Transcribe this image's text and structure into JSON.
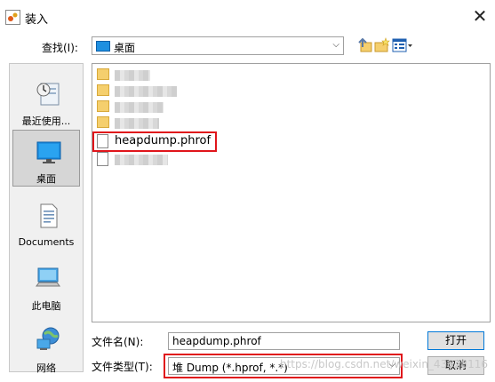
{
  "window": {
    "title": "装入",
    "close": "✕"
  },
  "lookin": {
    "label": "查找(I):",
    "value": "桌面",
    "arrow": "⌵"
  },
  "toolbar": {
    "icons": [
      "up-one-level-icon",
      "new-folder-icon",
      "view-menu-icon"
    ]
  },
  "places": [
    {
      "label": "最近使用...",
      "icon": "recent-items-icon"
    },
    {
      "label": "桌面",
      "icon": "desktop-icon",
      "selected": true
    },
    {
      "label": "Documents",
      "icon": "documents-icon"
    },
    {
      "label": "此电脑",
      "icon": "computer-icon"
    },
    {
      "label": "网络",
      "icon": "network-icon"
    }
  ],
  "files": {
    "visible_file": "heapdump.phrof"
  },
  "filename": {
    "label": "文件名(N):",
    "value": "heapdump.phrof"
  },
  "filetype": {
    "label": "文件类型(T):",
    "value": "堆 Dump (*.hprof, *.*)",
    "arrow": "⌵"
  },
  "buttons": {
    "open": "打开",
    "cancel": "取消"
  },
  "watermark": "https://blog.csdn.net/weixin_43828116",
  "colors": {
    "highlight": "#e0151b",
    "accent": "#0078d7"
  }
}
